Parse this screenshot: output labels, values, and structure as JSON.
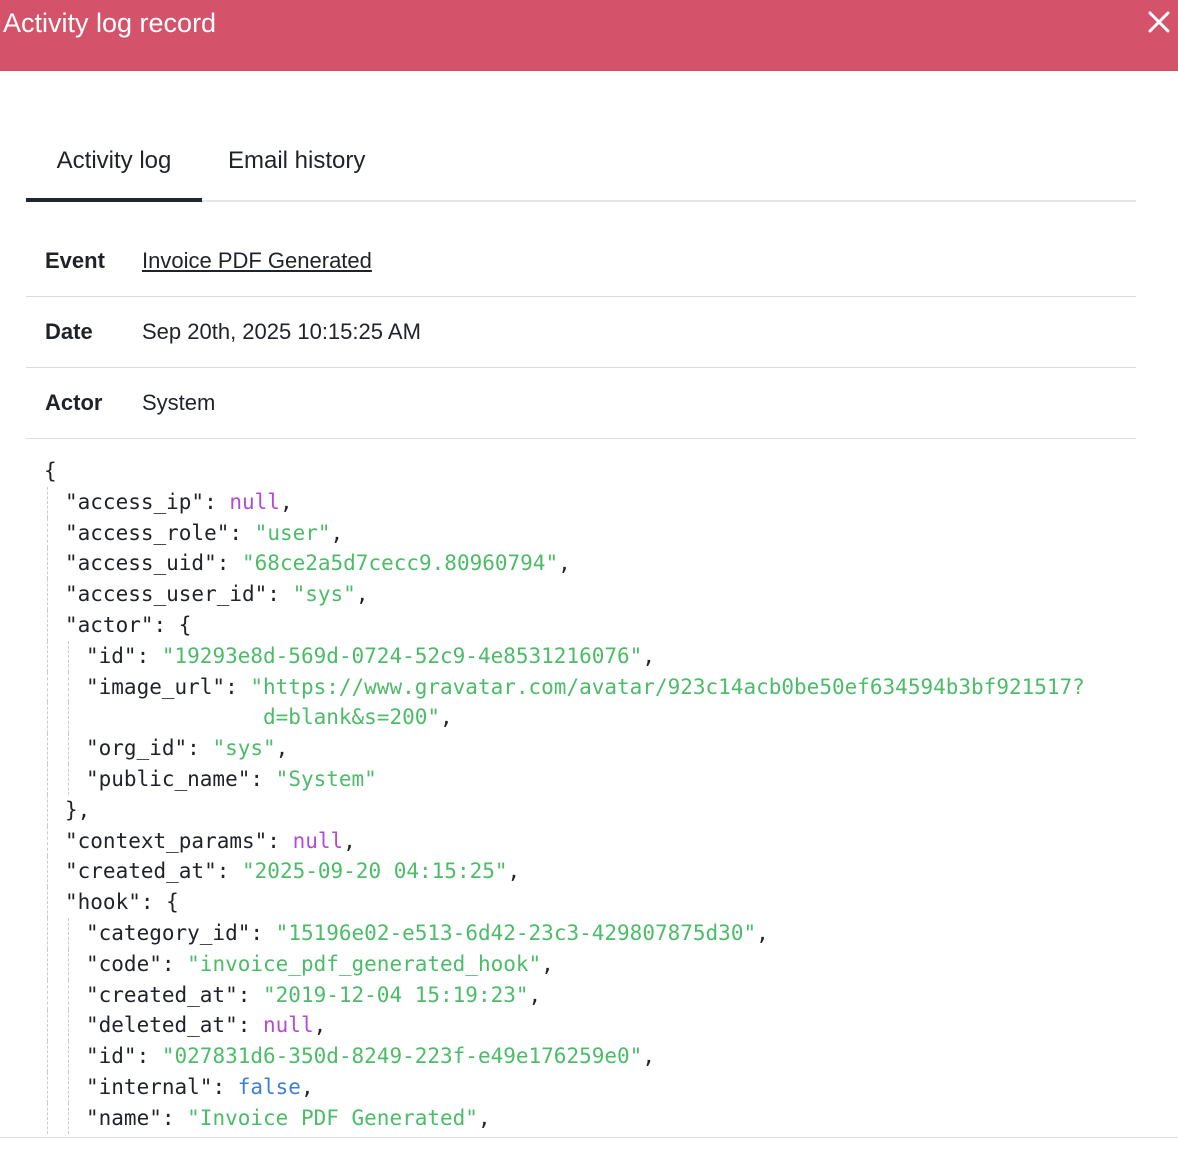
{
  "window": {
    "title": "Activity log record",
    "close_icon": "close-icon",
    "header_color": "#d4526a"
  },
  "tabs": [
    {
      "label": "Activity log",
      "active": true
    },
    {
      "label": "Email history",
      "active": false
    }
  ],
  "details": {
    "event_label": "Event",
    "event_value": "Invoice PDF Generated",
    "date_label": "Date",
    "date_value": "Sep 20th, 2025 10:15:25 AM",
    "actor_label": "Actor",
    "actor_value": "System"
  },
  "json_view": {
    "colors": {
      "key": "#1f2328",
      "string": "#4cbc68",
      "null": "#b34bd6",
      "boolean": "#3f7fd8"
    },
    "lines": [
      {
        "indent": 0,
        "parts": [
          {
            "t": "{",
            "c": "p"
          }
        ]
      },
      {
        "indent": 1,
        "parts": [
          {
            "t": "\"access_ip\"",
            "c": "k"
          },
          {
            "t": ": ",
            "c": "p"
          },
          {
            "t": "null",
            "c": "n"
          },
          {
            "t": ",",
            "c": "p"
          }
        ]
      },
      {
        "indent": 1,
        "parts": [
          {
            "t": "\"access_role\"",
            "c": "k"
          },
          {
            "t": ": ",
            "c": "p"
          },
          {
            "t": "\"user\"",
            "c": "s"
          },
          {
            "t": ",",
            "c": "p"
          }
        ]
      },
      {
        "indent": 1,
        "parts": [
          {
            "t": "\"access_uid\"",
            "c": "k"
          },
          {
            "t": ": ",
            "c": "p"
          },
          {
            "t": "\"68ce2a5d7cecc9.80960794\"",
            "c": "s"
          },
          {
            "t": ",",
            "c": "p"
          }
        ]
      },
      {
        "indent": 1,
        "parts": [
          {
            "t": "\"access_user_id\"",
            "c": "k"
          },
          {
            "t": ": ",
            "c": "p"
          },
          {
            "t": "\"sys\"",
            "c": "s"
          },
          {
            "t": ",",
            "c": "p"
          }
        ]
      },
      {
        "indent": 1,
        "parts": [
          {
            "t": "\"actor\"",
            "c": "k"
          },
          {
            "t": ": {",
            "c": "p"
          }
        ]
      },
      {
        "indent": 2,
        "parts": [
          {
            "t": "\"id\"",
            "c": "k"
          },
          {
            "t": ": ",
            "c": "p"
          },
          {
            "t": "\"19293e8d-569d-0724-52c9-4e8531216076\"",
            "c": "s"
          },
          {
            "t": ",",
            "c": "p"
          }
        ]
      },
      {
        "indent": 2,
        "parts": [
          {
            "t": "\"image_url\"",
            "c": "k"
          },
          {
            "t": ": ",
            "c": "p"
          },
          {
            "t": "\"https://www.gravatar.com/avatar/923c14acb0be50ef634594b3bf921517?",
            "c": "s"
          }
        ]
      },
      {
        "indent": 2,
        "parts": [
          {
            "t": "              ",
            "c": "p"
          },
          {
            "t": "d=blank&s=200\"",
            "c": "s"
          },
          {
            "t": ",",
            "c": "p"
          }
        ]
      },
      {
        "indent": 2,
        "parts": [
          {
            "t": "\"org_id\"",
            "c": "k"
          },
          {
            "t": ": ",
            "c": "p"
          },
          {
            "t": "\"sys\"",
            "c": "s"
          },
          {
            "t": ",",
            "c": "p"
          }
        ]
      },
      {
        "indent": 2,
        "parts": [
          {
            "t": "\"public_name\"",
            "c": "k"
          },
          {
            "t": ": ",
            "c": "p"
          },
          {
            "t": "\"System\"",
            "c": "s"
          }
        ]
      },
      {
        "indent": 1,
        "parts": [
          {
            "t": "},",
            "c": "p"
          }
        ]
      },
      {
        "indent": 1,
        "parts": [
          {
            "t": "\"context_params\"",
            "c": "k"
          },
          {
            "t": ": ",
            "c": "p"
          },
          {
            "t": "null",
            "c": "n"
          },
          {
            "t": ",",
            "c": "p"
          }
        ]
      },
      {
        "indent": 1,
        "parts": [
          {
            "t": "\"created_at\"",
            "c": "k"
          },
          {
            "t": ": ",
            "c": "p"
          },
          {
            "t": "\"2025-09-20 04:15:25\"",
            "c": "s"
          },
          {
            "t": ",",
            "c": "p"
          }
        ]
      },
      {
        "indent": 1,
        "parts": [
          {
            "t": "\"hook\"",
            "c": "k"
          },
          {
            "t": ": {",
            "c": "p"
          }
        ]
      },
      {
        "indent": 2,
        "parts": [
          {
            "t": "\"category_id\"",
            "c": "k"
          },
          {
            "t": ": ",
            "c": "p"
          },
          {
            "t": "\"15196e02-e513-6d42-23c3-429807875d30\"",
            "c": "s"
          },
          {
            "t": ",",
            "c": "p"
          }
        ]
      },
      {
        "indent": 2,
        "parts": [
          {
            "t": "\"code\"",
            "c": "k"
          },
          {
            "t": ": ",
            "c": "p"
          },
          {
            "t": "\"invoice_pdf_generated_hook\"",
            "c": "s"
          },
          {
            "t": ",",
            "c": "p"
          }
        ]
      },
      {
        "indent": 2,
        "parts": [
          {
            "t": "\"created_at\"",
            "c": "k"
          },
          {
            "t": ": ",
            "c": "p"
          },
          {
            "t": "\"2019-12-04 15:19:23\"",
            "c": "s"
          },
          {
            "t": ",",
            "c": "p"
          }
        ]
      },
      {
        "indent": 2,
        "parts": [
          {
            "t": "\"deleted_at\"",
            "c": "k"
          },
          {
            "t": ": ",
            "c": "p"
          },
          {
            "t": "null",
            "c": "n"
          },
          {
            "t": ",",
            "c": "p"
          }
        ]
      },
      {
        "indent": 2,
        "parts": [
          {
            "t": "\"id\"",
            "c": "k"
          },
          {
            "t": ": ",
            "c": "p"
          },
          {
            "t": "\"027831d6-350d-8249-223f-e49e176259e0\"",
            "c": "s"
          },
          {
            "t": ",",
            "c": "p"
          }
        ]
      },
      {
        "indent": 2,
        "parts": [
          {
            "t": "\"internal\"",
            "c": "k"
          },
          {
            "t": ": ",
            "c": "p"
          },
          {
            "t": "false",
            "c": "b"
          },
          {
            "t": ",",
            "c": "p"
          }
        ]
      },
      {
        "indent": 2,
        "parts": [
          {
            "t": "\"name\"",
            "c": "k"
          },
          {
            "t": ": ",
            "c": "p"
          },
          {
            "t": "\"Invoice PDF Generated\"",
            "c": "s"
          },
          {
            "t": ",",
            "c": "p"
          }
        ]
      }
    ]
  }
}
